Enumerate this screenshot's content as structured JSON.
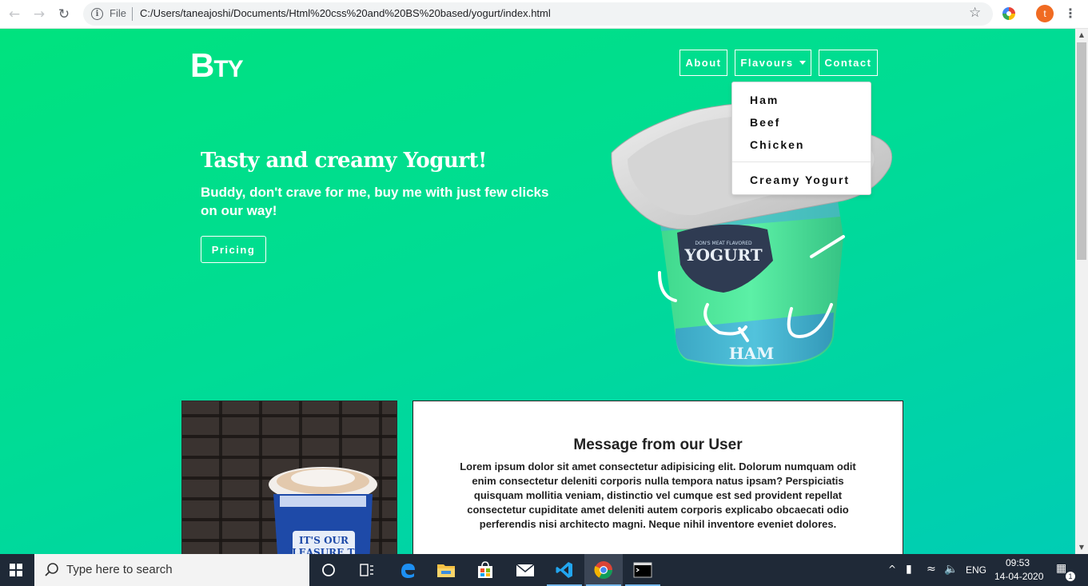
{
  "browser": {
    "file_label": "File",
    "url": "C:/Users/taneajoshi/Documents/Html%20css%20and%20BS%20based/yogurt/index.html",
    "profile_initial": "t"
  },
  "site": {
    "brand_big": "B",
    "brand_small": "TY",
    "nav": {
      "about": "About",
      "flavours": "Flavours",
      "contact": "Contact"
    },
    "dropdown": [
      "Ham",
      "Beef",
      "Chicken"
    ],
    "dropdown_extra": "Creamy Yogurt",
    "hero": {
      "title": "Tasty and creamy Yogurt!",
      "subtitle": "Buddy, don't crave for me, buy me with just few clicks on our way!",
      "button": "Pricing"
    },
    "cup": {
      "lid_text": "DON'S MEAT FLAVORED",
      "brand": "YOGURT",
      "flavor": "HAM"
    },
    "photo_cup_text": [
      "IT'S OUR",
      "PLEASURE TO"
    ],
    "message": {
      "title": "Message from our User",
      "body": "Lorem ipsum dolor sit amet consectetur adipisicing elit. Dolorum numquam odit enim consectetur deleniti corporis nulla tempora natus ipsam? Perspiciatis quisquam mollitia veniam, distinctio vel cumque est sed provident repellat consectetur cupiditate amet deleniti autem corporis explicabo obcaecati odio perferendis nisi architecto magni. Neque nihil inventore eveniet dolores."
    }
  },
  "taskbar": {
    "search_placeholder": "Type here to search",
    "language": "ENG",
    "time": "09:53",
    "date": "14-04-2020",
    "notification_count": "1"
  },
  "colors": {
    "bg_start": "#00e27e",
    "bg_end": "#00cdb4",
    "cup_green": "#4be39a",
    "cup_blue": "#46b2cd",
    "label_navy": "#2f3b52"
  }
}
